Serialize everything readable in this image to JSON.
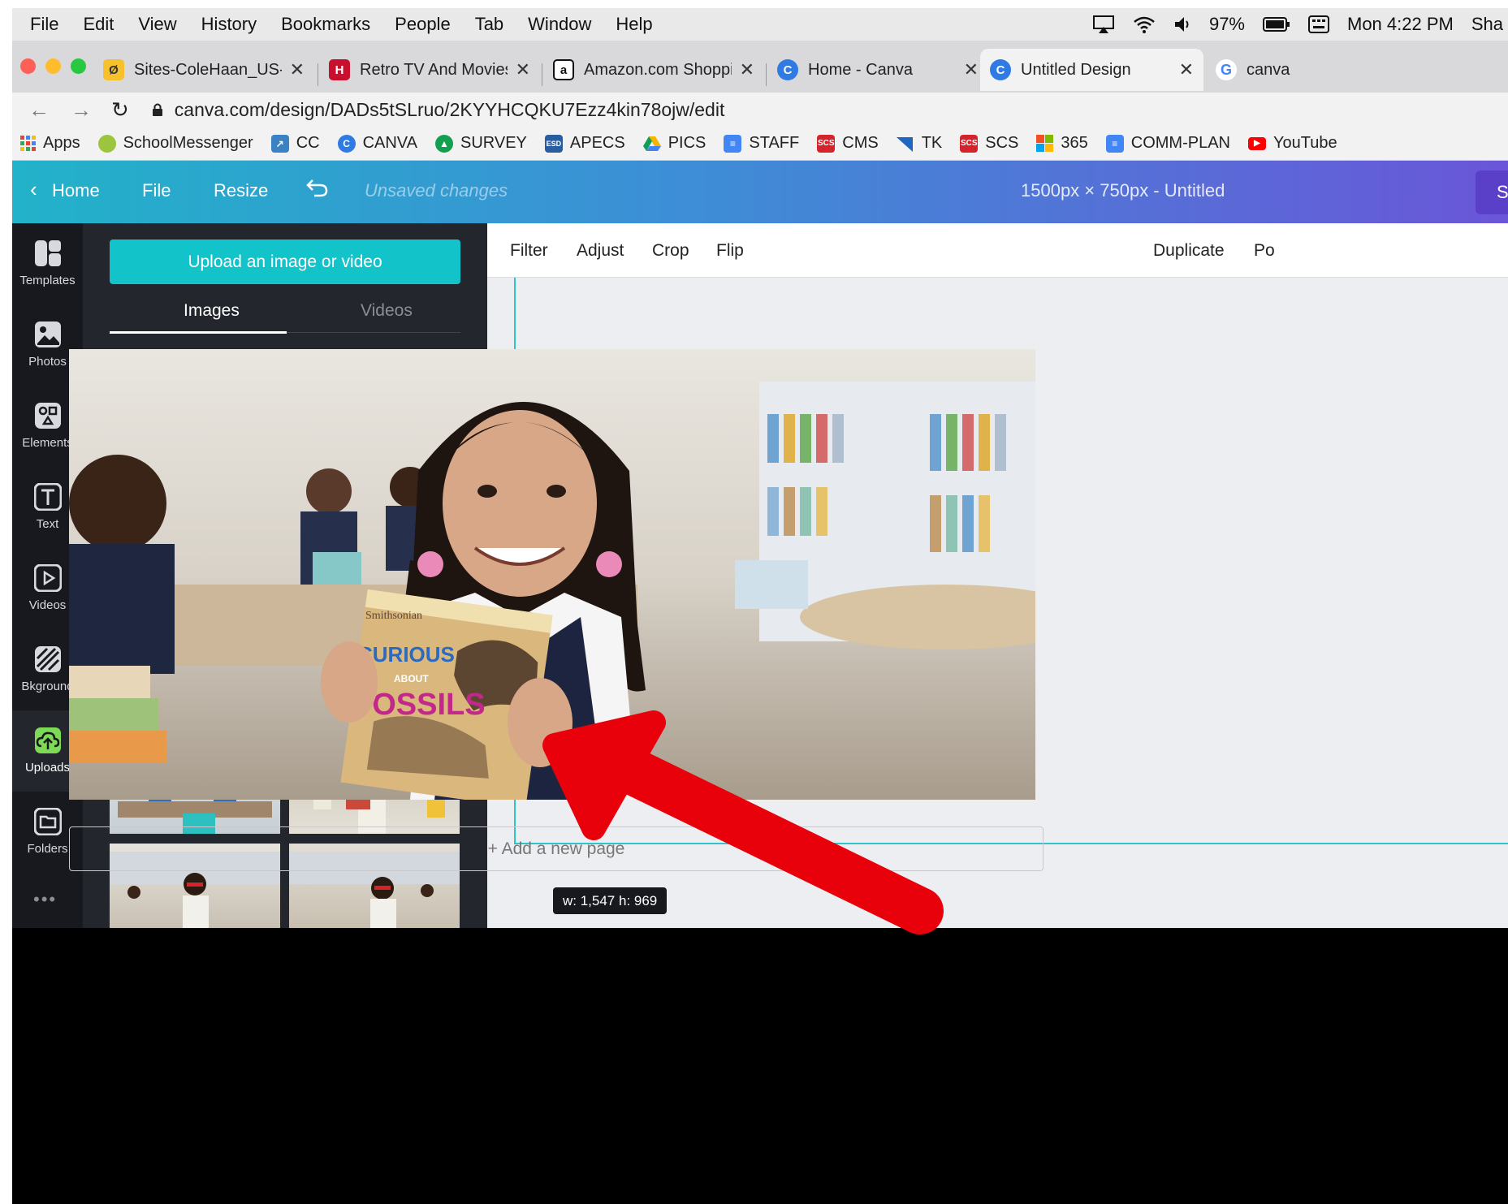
{
  "menubar": {
    "items": [
      "File",
      "Edit",
      "View",
      "History",
      "Bookmarks",
      "People",
      "Tab",
      "Window",
      "Help"
    ],
    "battery": "97%",
    "clock": "Mon 4:22 PM",
    "user": "Sha"
  },
  "tabs": [
    {
      "title": "Sites-ColeHaan_US-Site",
      "icon": "sites-icon",
      "color": "#f6c12b"
    },
    {
      "title": "Retro TV And Movies Po",
      "icon": "history-h-icon",
      "color": "#c8102e"
    },
    {
      "title": "Amazon.com Shopping",
      "icon": "amazon-icon",
      "color": "#111111"
    },
    {
      "title": "Home - Canva",
      "icon": "canva-icon",
      "color": "#2f7ae3"
    },
    {
      "title": "Untitled Design",
      "icon": "canva-icon",
      "color": "#2f7ae3"
    },
    {
      "title": "canva",
      "icon": "google-icon",
      "color": "#ffffff"
    }
  ],
  "address": {
    "url": "canva.com/design/DADs5tSLruo/2KYYHCQKU7Ezz4kin78ojw/edit"
  },
  "bookmarks": [
    {
      "label": "Apps",
      "color": "#e94235"
    },
    {
      "label": "SchoolMessenger",
      "color": "#9bc53d"
    },
    {
      "label": "CC",
      "color": "#3b82c4"
    },
    {
      "label": "CANVA",
      "color": "#2f7ae3"
    },
    {
      "label": "SURVEY",
      "color": "#12a050"
    },
    {
      "label": "APECS",
      "color": "#2a5d9f"
    },
    {
      "label": "PICS",
      "color": "#f4b400"
    },
    {
      "label": "STAFF",
      "color": "#4285f4"
    },
    {
      "label": "CMS",
      "color": "#d4232b"
    },
    {
      "label": "TK",
      "color": "#1f66c1"
    },
    {
      "label": "SCS",
      "color": "#d4232b"
    },
    {
      "label": "365",
      "color": "#f25022"
    },
    {
      "label": "COMM-PLAN",
      "color": "#4285f4"
    },
    {
      "label": "YouTube",
      "color": "#ff0000"
    }
  ],
  "canva_header": {
    "home": "Home",
    "file": "File",
    "resize": "Resize",
    "status": "Unsaved changes",
    "doc_title": "1500px × 750px - Untitled",
    "share": "S"
  },
  "rail": [
    {
      "label": "Templates",
      "icon": "templates-icon"
    },
    {
      "label": "Photos",
      "icon": "photos-icon"
    },
    {
      "label": "Elements",
      "icon": "elements-icon"
    },
    {
      "label": "Text",
      "icon": "text-icon"
    },
    {
      "label": "Videos",
      "icon": "videos-icon"
    },
    {
      "label": "Bkground",
      "icon": "background-icon"
    },
    {
      "label": "Uploads",
      "icon": "uploads-icon"
    },
    {
      "label": "Folders",
      "icon": "folders-icon"
    }
  ],
  "rail_more": "•••",
  "panel": {
    "upload_label": "Upload an image or video",
    "tab_images": "Images",
    "tab_videos": "Videos"
  },
  "toolbar": {
    "filter": "Filter",
    "adjust": "Adjust",
    "crop": "Crop",
    "flip": "Flip",
    "duplicate": "Duplicate",
    "position": "Po"
  },
  "canvas": {
    "add_page": "+ Add a new page",
    "dims": "w: 1,547 h: 969"
  },
  "photo_text": {
    "brand": "Smithsonian",
    "title_1": "CURIOUS",
    "title_2": "ABOUT",
    "title_3": "FOSSILS"
  },
  "colors": {
    "canva_teal": "#12c4c9",
    "canva_purple": "#6a56d8",
    "arrow_red": "#e8000b"
  }
}
